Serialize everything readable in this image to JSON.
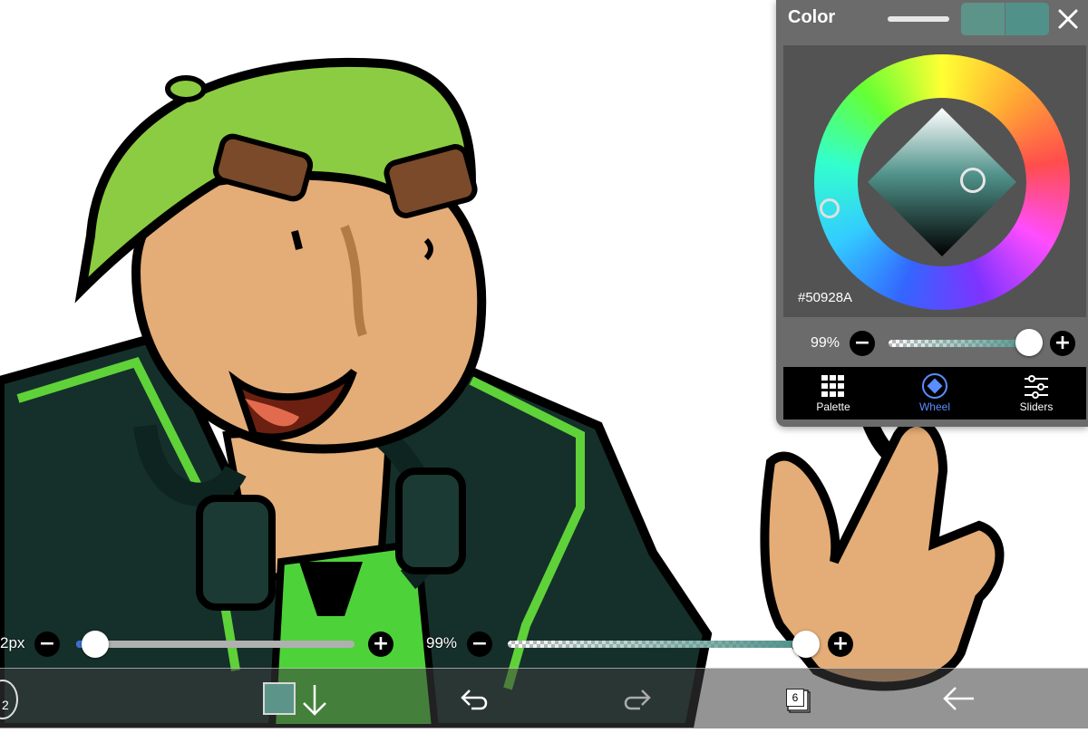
{
  "color_panel": {
    "title": "Color",
    "hex_value": "#50928A",
    "opacity_label": "99%",
    "current_color": "#50928a",
    "previous_color": "#5c948a",
    "opacity_fraction": 0.99,
    "tabs": [
      {
        "label": "Palette",
        "icon": "grid-icon",
        "active": false
      },
      {
        "label": "Wheel",
        "icon": "diamond-icon",
        "active": true
      },
      {
        "label": "Sliders",
        "icon": "sliders-icon",
        "active": false
      }
    ]
  },
  "bottom_sliders": {
    "brush_size_label": "2px",
    "brush_size_fraction": 0.03,
    "opacity_label": "99%",
    "opacity_fraction": 0.99
  },
  "toolbar": {
    "brush_size_number": "2",
    "layer_count": "6",
    "icons": [
      "brush-icon",
      "color-swatch",
      "download-arrow-icon",
      "undo-icon",
      "redo-icon",
      "layers-icon",
      "back-arrow-icon"
    ]
  },
  "colors": {
    "accent_blue": "#5a8dff",
    "panel_bg": "#6b6b6b"
  }
}
